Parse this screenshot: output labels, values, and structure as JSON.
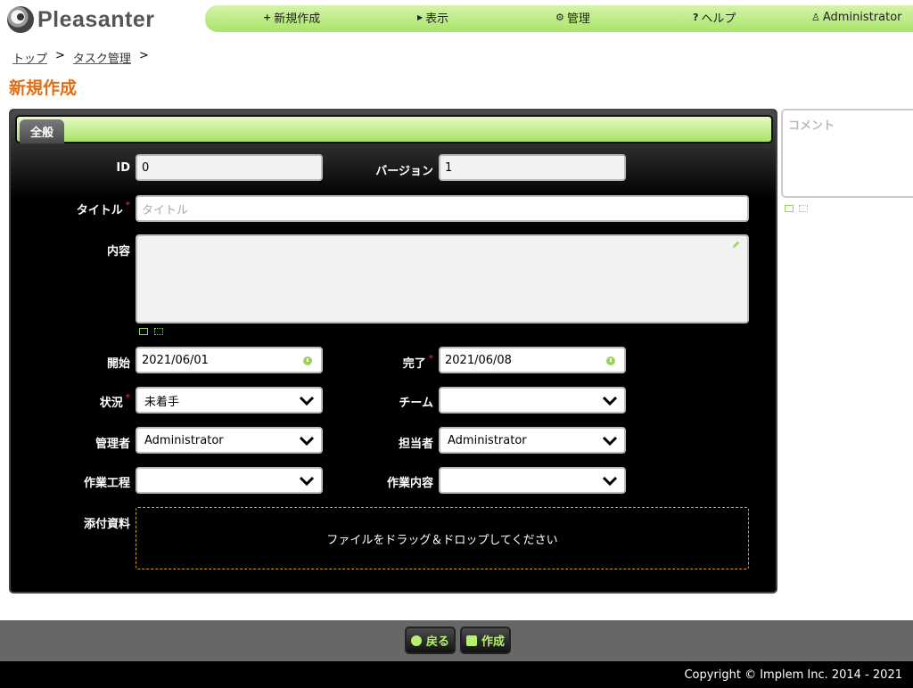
{
  "app": {
    "logo_text": "Pleasanter"
  },
  "nav": {
    "new": {
      "icon": "plus-icon",
      "label": "新規作成"
    },
    "view": {
      "icon": "triangle-right-icon",
      "label": "表示"
    },
    "manage": {
      "icon": "gear-icon",
      "label": "管理"
    },
    "help": {
      "icon": "question-icon",
      "label": "ヘルプ"
    },
    "user": {
      "icon": "user-icon",
      "label": "Administrator"
    }
  },
  "breadcrumb": {
    "items": [
      "トップ",
      "タスク管理"
    ],
    "separator": ">"
  },
  "page_title": "新規作成",
  "tabs": [
    {
      "label": "全般"
    }
  ],
  "form": {
    "id": {
      "label": "ID",
      "value": "0"
    },
    "version": {
      "label": "バージョン",
      "value": "1"
    },
    "title": {
      "label": "タイトル",
      "placeholder": "タイトル"
    },
    "body": {
      "label": "内容"
    },
    "start": {
      "label": "開始",
      "value": "2021/06/01"
    },
    "complete": {
      "label": "完了",
      "value": "2021/06/08"
    },
    "status": {
      "label": "状況",
      "value": "未着手"
    },
    "team": {
      "label": "チーム",
      "value": ""
    },
    "manager": {
      "label": "管理者",
      "value": "Administrator"
    },
    "owner": {
      "label": "担当者",
      "value": "Administrator"
    },
    "class_a": {
      "label": "作業工程",
      "value": ""
    },
    "class_b": {
      "label": "作業内容",
      "value": ""
    },
    "attachments": {
      "label": "添付資料",
      "drop_text": "ファイルをドラッグ＆ドロップしてください"
    },
    "required_mark": "*"
  },
  "comment": {
    "placeholder": "コメント"
  },
  "buttons": {
    "back": "戻る",
    "create": "作成"
  },
  "footer": {
    "copyright": "Copyright © Implem Inc. 2014 - 2021"
  },
  "colors": {
    "accent_green": "#a9e46a",
    "title_orange": "#e06e16",
    "panel": "#000000",
    "required": "#ee1122"
  }
}
